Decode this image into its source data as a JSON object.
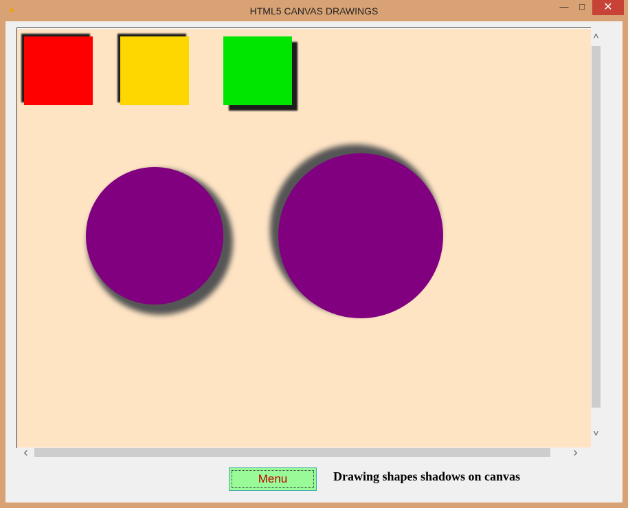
{
  "window": {
    "title": "HTML5 CANVAS DRAWINGS",
    "minimize_glyph": "—",
    "maximize_glyph": "□",
    "close_glyph": "✕",
    "app_icon": "sparkle-icon"
  },
  "canvas": {
    "background": "#ffe4c4",
    "shapes": [
      {
        "kind": "square",
        "fill": "#ff0000",
        "shadow": "#1a1a1a"
      },
      {
        "kind": "square",
        "fill": "#ffd700",
        "shadow": "#1a1a1a"
      },
      {
        "kind": "square",
        "fill": "#00e600",
        "shadow": "#1a1a1a"
      },
      {
        "kind": "circle",
        "fill": "#800080",
        "shadow": "#555555"
      },
      {
        "kind": "circle",
        "fill": "#800080",
        "shadow": "#555555"
      }
    ]
  },
  "scroll": {
    "up_glyph": "˄",
    "down_glyph": "˅",
    "left_glyph": "‹",
    "right_glyph": "›"
  },
  "footer": {
    "menu_label": "Menu",
    "caption": "Drawing  shapes shadows on canvas"
  }
}
